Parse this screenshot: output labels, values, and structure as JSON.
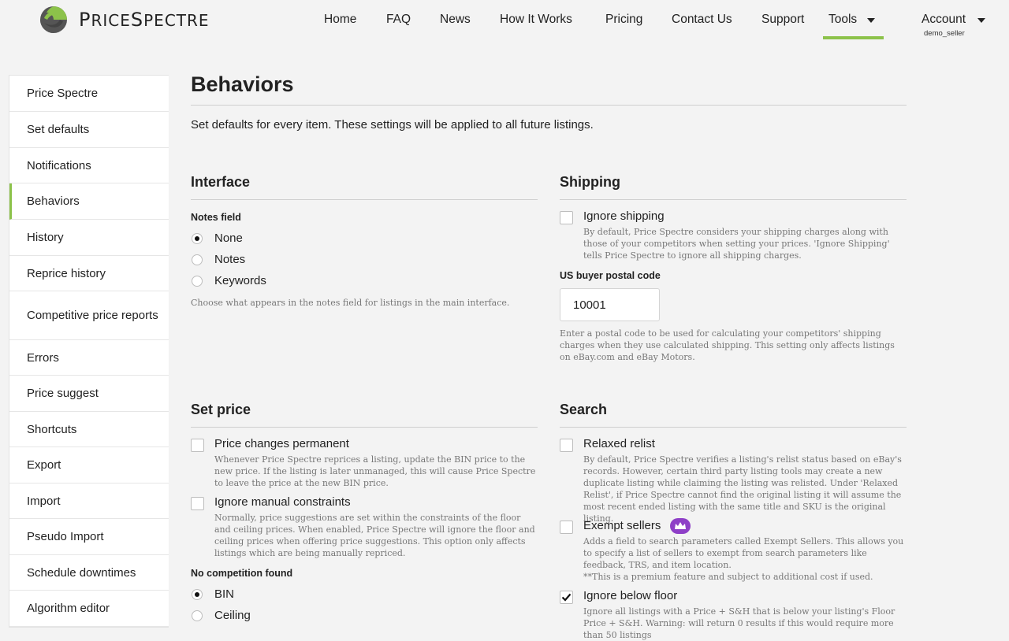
{
  "brand": {
    "name": "PRICESPECTRE",
    "initial": "P",
    "rest": "RICE",
    "initial2": "S",
    "rest2": "PECTRE"
  },
  "nav": {
    "items": [
      "Home",
      "FAQ",
      "News",
      "How It Works",
      "Pricing",
      "Contact Us",
      "Support"
    ],
    "tools": "Tools",
    "account": "Account",
    "account_user": "demo_seller"
  },
  "sidebar": {
    "items": [
      "Price Spectre",
      "Set defaults",
      "Notifications",
      "Behaviors",
      "History",
      "Reprice history",
      "Competitive price reports",
      "Errors",
      "Price suggest",
      "Shortcuts",
      "Export",
      "Import",
      "Pseudo Import",
      "Schedule downtimes",
      "Algorithm editor"
    ],
    "active": "Behaviors"
  },
  "page": {
    "title": "Behaviors",
    "subtitle": "Set defaults for every item. These settings will be applied to all future listings."
  },
  "interface": {
    "title": "Interface",
    "notes_label": "Notes field",
    "options": [
      "None",
      "Notes",
      "Keywords"
    ],
    "selected": "None",
    "help": "Choose what appears in the notes field for listings in the main interface."
  },
  "shipping": {
    "title": "Shipping",
    "ignore_label": "Ignore shipping",
    "ignore_checked": false,
    "ignore_help": "By default, Price Spectre considers your shipping charges along with those of your competitors when setting your prices. 'Ignore Shipping' tells Price Spectre to ignore all shipping charges.",
    "postal_label": "US buyer postal code",
    "postal_value": "10001",
    "postal_help": "Enter a postal code to be used for calculating your competitors' shipping charges when they use calculated shipping. This setting only affects listings on eBay.com and eBay Motors."
  },
  "set_price": {
    "title": "Set price",
    "permanent_label": "Price changes permanent",
    "permanent_checked": false,
    "permanent_help": "Whenever Price Spectre reprices a listing, update the BIN price to the new price. If the listing is later unmanaged, this will cause Price Spectre to leave the price at the new BIN price.",
    "manual_label": "Ignore manual constraints",
    "manual_checked": false,
    "manual_help": "Normally, price suggestions are set within the constraints of the floor and ceiling prices. When enabled, Price Spectre will ignore the floor and ceiling prices when offering price suggestions. This option only affects listings which are being manually repriced.",
    "no_comp_label": "No competition found",
    "no_comp_options": [
      "BIN",
      "Ceiling"
    ],
    "no_comp_selected": "BIN"
  },
  "search": {
    "title": "Search",
    "relaxed_label": "Relaxed relist",
    "relaxed_checked": false,
    "relaxed_help": "By default, Price Spectre verifies a listing's relist status based on eBay's records. However, certain third party listing tools may create a new duplicate listing while claiming the listing was relisted. Under 'Relaxed Relist', if Price Spectre cannot find the original listing it will assume the most recent ended listing with the same title and SKU is the original listing.",
    "exempt_label": "Exempt sellers",
    "exempt_checked": false,
    "exempt_icon": "crown-icon",
    "exempt_help": "Adds a field to search parameters called Exempt Sellers. This allows you to specify a list of sellers to exempt from search parameters like feedback, TRS, and item location.",
    "exempt_note": "**This is a premium feature and subject to additional cost if used.",
    "below_floor_label": "Ignore below floor",
    "below_floor_checked": true,
    "below_floor_help": "Ignore all listings with a Price + S&H that is below your listing's Floor Price + S&H. Warning: will return 0 results if this would require more than 50 listings"
  },
  "colors": {
    "accent": "#8cc24a",
    "premium": "#8e3fc7",
    "background": "#f3f3f3"
  }
}
